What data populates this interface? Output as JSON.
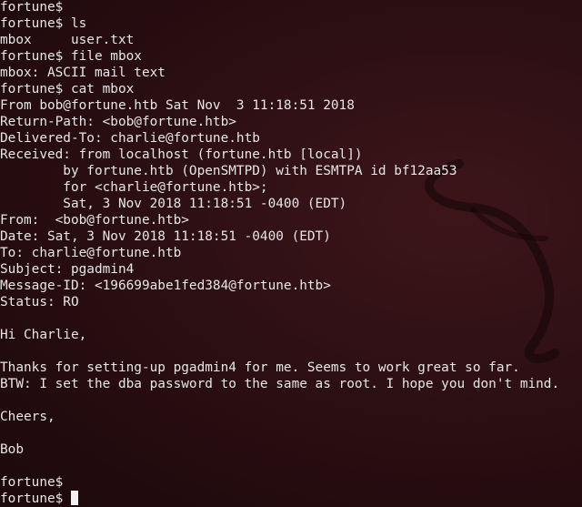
{
  "terminal": {
    "background_color": "#2a0f12",
    "text_color": "#e6e6e6",
    "cursor_color": "#f2f2f2",
    "lines": [
      "fortune$",
      "fortune$ ls",
      "mbox     user.txt",
      "fortune$ file mbox",
      "mbox: ASCII mail text",
      "fortune$ cat mbox",
      "From bob@fortune.htb Sat Nov  3 11:18:51 2018",
      "Return-Path: <bob@fortune.htb>",
      "Delivered-To: charlie@fortune.htb",
      "Received: from localhost (fortune.htb [local])",
      "        by fortune.htb (OpenSMTPD) with ESMTPA id bf12aa53",
      "        for <charlie@fortune.htb>;",
      "        Sat, 3 Nov 2018 11:18:51 -0400 (EDT)",
      "From:  <bob@fortune.htb>",
      "Date: Sat, 3 Nov 2018 11:18:51 -0400 (EDT)",
      "To: charlie@fortune.htb",
      "Subject: pgadmin4",
      "Message-ID: <196699abe1fed384@fortune.htb>",
      "Status: RO",
      "",
      "Hi Charlie,",
      "",
      "Thanks for setting-up pgadmin4 for me. Seems to work great so far.",
      "BTW: I set the dba password to the same as root. I hope you don't mind.",
      "",
      "Cheers,",
      "",
      "Bob",
      "",
      "fortune$",
      "fortune$"
    ]
  }
}
